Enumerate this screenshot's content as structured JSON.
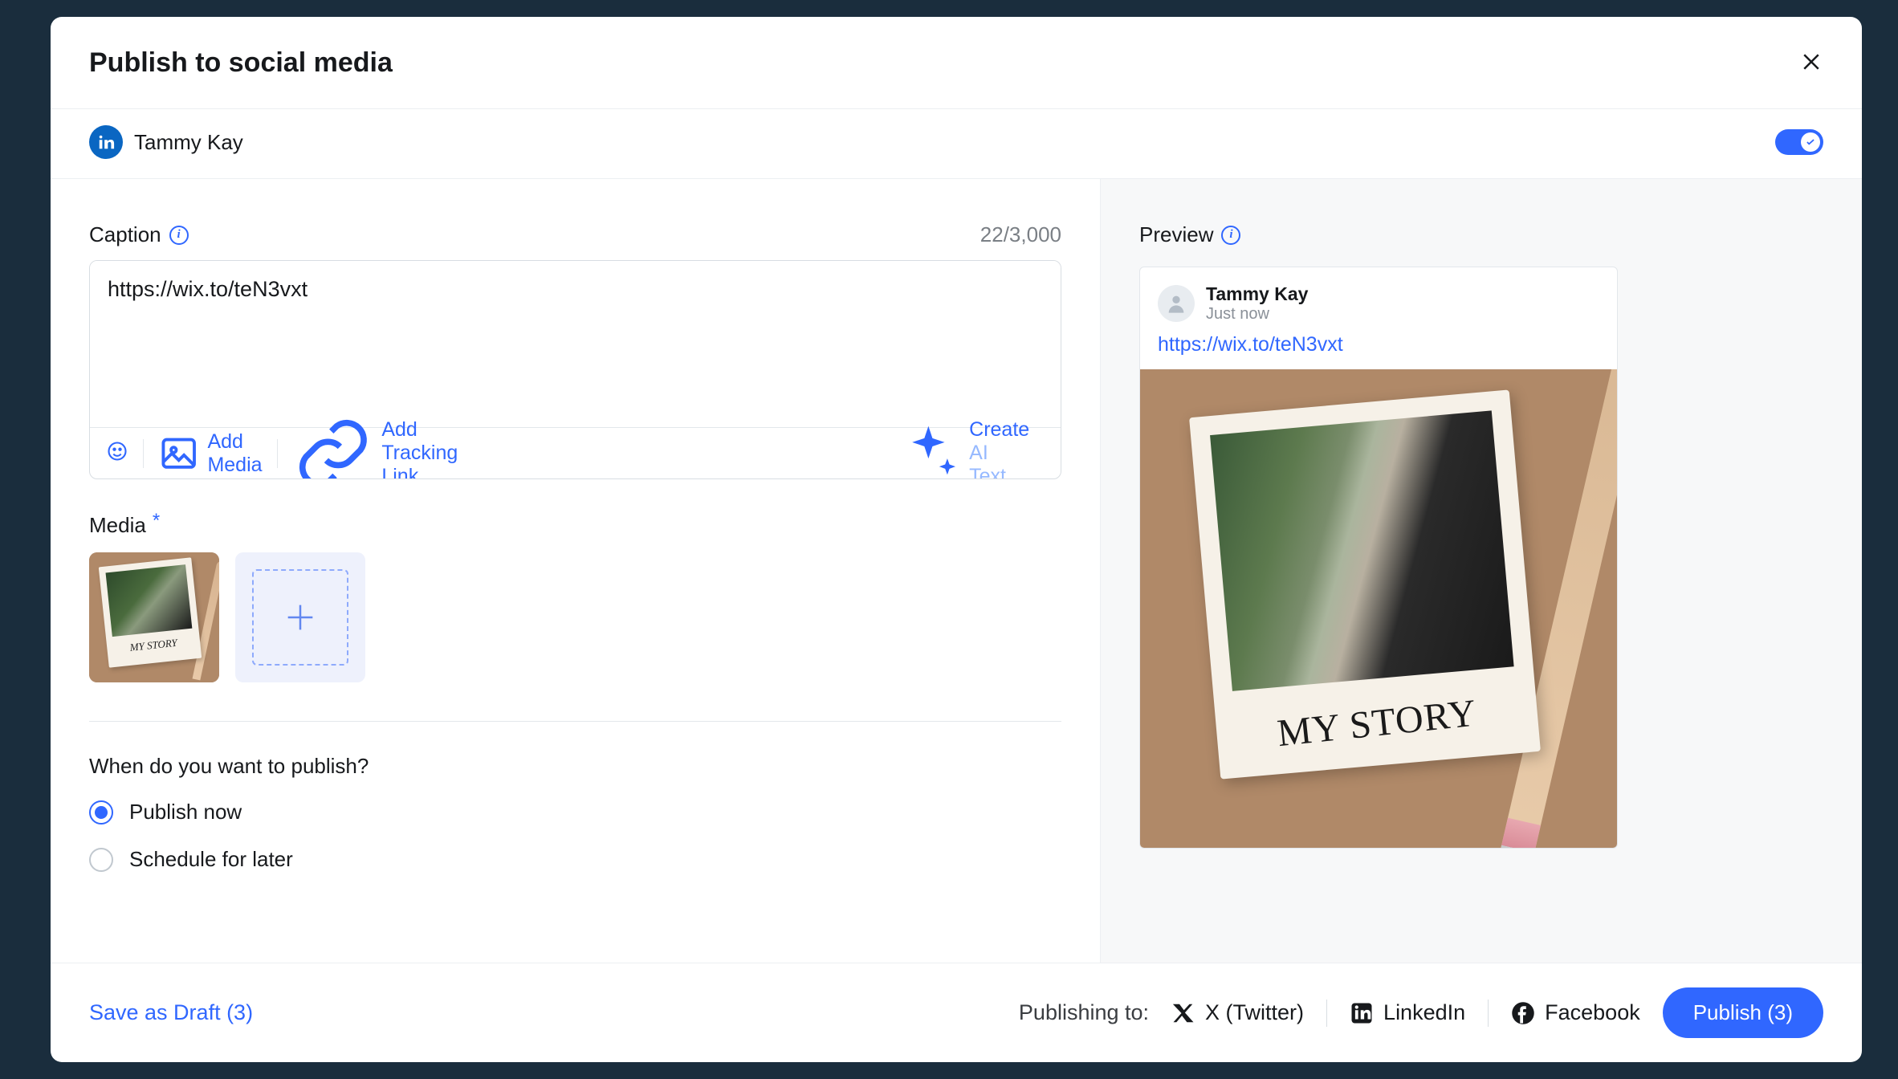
{
  "modal": {
    "title": "Publish to social media"
  },
  "account": {
    "name": "Tammy Kay"
  },
  "caption": {
    "label": "Caption",
    "count": "22/3,000",
    "value": "https://wix.to/teN3vxt",
    "toolbar": {
      "add_media": "Add Media",
      "add_tracking": "Add Tracking Link",
      "create_ai_prefix": "Create ",
      "create_ai_suffix": "AI Text"
    }
  },
  "media": {
    "label": "Media",
    "thumb_caption": "MY STORY"
  },
  "schedule": {
    "label": "When do you want to publish?",
    "option1": "Publish now",
    "option2": "Schedule for later"
  },
  "preview": {
    "label": "Preview",
    "name": "Tammy Kay",
    "time": "Just now",
    "link": "https://wix.to/teN3vxt",
    "polaroid_caption": "MY STORY"
  },
  "footer": {
    "save_draft": "Save as Draft (3)",
    "publishing_to": "Publishing to:",
    "platforms": {
      "twitter": "X (Twitter)",
      "linkedin": "LinkedIn",
      "facebook": "Facebook"
    },
    "publish_btn": "Publish (3)"
  }
}
